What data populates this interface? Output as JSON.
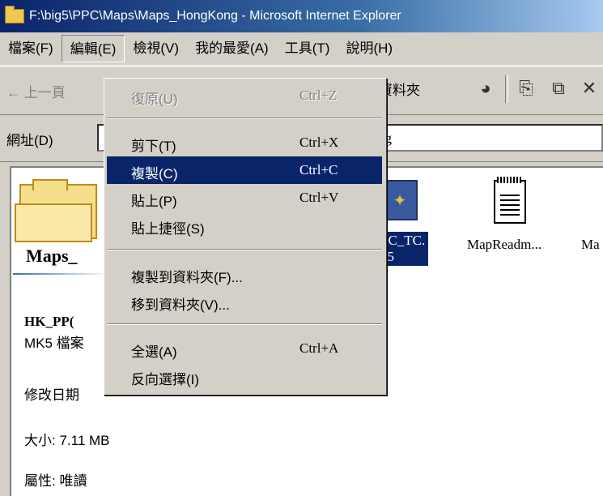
{
  "window": {
    "title": "F:\\big5\\PPC\\Maps\\Maps_HongKong - Microsoft Internet Explorer"
  },
  "menubar": {
    "items": [
      {
        "label": "檔案(F)"
      },
      {
        "label": "編輯(E)"
      },
      {
        "label": "檢視(V)"
      },
      {
        "label": "我的最愛(A)"
      },
      {
        "label": "工具(T)"
      },
      {
        "label": "說明(H)"
      }
    ]
  },
  "toolbar": {
    "back_label": "← 上一頁",
    "folders_label": "資料夾"
  },
  "address": {
    "label": "網址(D)",
    "value_visible": "ng"
  },
  "edit_menu": {
    "undo": {
      "label": "復原(U)",
      "shortcut": "Ctrl+Z"
    },
    "cut": {
      "label": "剪下(T)",
      "shortcut": "Ctrl+X"
    },
    "copy": {
      "label": "複製(C)",
      "shortcut": "Ctrl+C"
    },
    "paste": {
      "label": "貼上(P)",
      "shortcut": "Ctrl+V"
    },
    "paste_shortcut": {
      "label": "貼上捷徑(S)"
    },
    "copy_to": {
      "label": "複製到資料夾(F)..."
    },
    "move_to": {
      "label": "移到資料夾(V)..."
    },
    "select_all": {
      "label": "全選(A)",
      "shortcut": "Ctrl+A"
    },
    "invert": {
      "label": "反向選擇(I)"
    }
  },
  "content": {
    "folder_name": "Maps_",
    "selected_name": "HK_PP(",
    "file_type": "MK5 檔案",
    "modified_label": "修改日期",
    "size": "大小: 7.11 MB",
    "attributes": "屬性: 唯讀",
    "files": {
      "selected_label_line1": "PC_TC.",
      "selected_label_line2": "k5",
      "readme_label": "MapReadm...",
      "partial_label": "Ma"
    }
  }
}
